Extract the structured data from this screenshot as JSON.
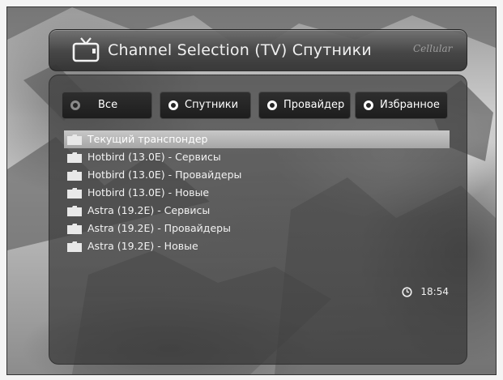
{
  "header": {
    "title": "Channel Selection  (TV) Спутники",
    "logo_text": "Cellular",
    "icon": "tv-icon"
  },
  "tabs": [
    {
      "label": "Все",
      "active": true
    },
    {
      "label": "Спутники",
      "active": false
    },
    {
      "label": "Провайдер",
      "active": false
    },
    {
      "label": "Избранное",
      "active": false
    }
  ],
  "list": {
    "icon": "folder-icon",
    "items": [
      {
        "label": "Текущий транспондер",
        "selected": true
      },
      {
        "label": "Hotbird (13.0E) - Сервисы",
        "selected": false
      },
      {
        "label": "Hotbird (13.0E) - Провайдеры",
        "selected": false
      },
      {
        "label": "Hotbird (13.0E) - Новые",
        "selected": false
      },
      {
        "label": "Astra (19.2E) - Сервисы",
        "selected": false
      },
      {
        "label": "Astra (19.2E) - Провайдеры",
        "selected": false
      },
      {
        "label": "Astra (19.2E) - Новые",
        "selected": false
      }
    ]
  },
  "status": {
    "time": "18:54",
    "icon": "clock-icon"
  },
  "colors": {
    "selection": "#b5b5b5",
    "panel": "#3c3c3c",
    "text": "#f2f2f2"
  }
}
